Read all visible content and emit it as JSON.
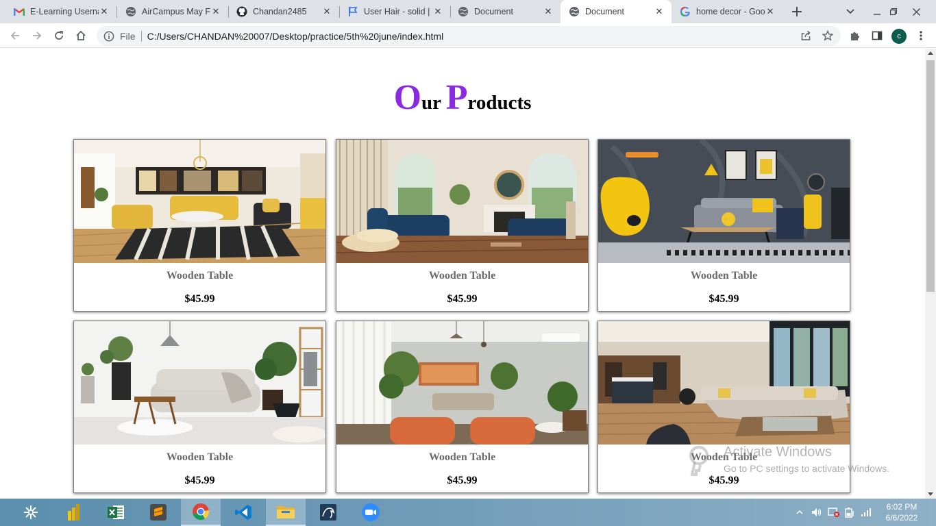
{
  "browser": {
    "tabs": [
      {
        "title": "E-Learning Userna",
        "icon": "gmail-icon",
        "active": false
      },
      {
        "title": "AirCampus May Fu",
        "icon": "globe-icon",
        "active": false
      },
      {
        "title": "Chandan2485",
        "icon": "github-icon",
        "active": false
      },
      {
        "title": "User Hair - solid | F",
        "icon": "flag-icon",
        "active": false
      },
      {
        "title": "Document",
        "icon": "globe-icon",
        "active": false
      },
      {
        "title": "Document",
        "icon": "globe-icon",
        "active": true
      },
      {
        "title": "home decor - Goo",
        "icon": "google-icon",
        "active": false
      }
    ],
    "new_tab_symbol": "+",
    "url_scheme": "File",
    "url": "C:/Users/CHANDAN%20007/Desktop/practice/5th%20june/index.html",
    "profile_initial": "c"
  },
  "page": {
    "heading_first_letter": "O",
    "heading_first_rest": "ur",
    "heading_second_letter": "P",
    "heading_second_rest": "roducts",
    "heading_accent_color": "#8a2be2",
    "products": [
      {
        "name": "Wooden Table",
        "price": "$45.99"
      },
      {
        "name": "Wooden Table",
        "price": "$45.99"
      },
      {
        "name": "Wooden Table",
        "price": "$45.99"
      },
      {
        "name": "Wooden Table",
        "price": "$45.99"
      },
      {
        "name": "Wooden Table",
        "price": "$45.99"
      },
      {
        "name": "Wooden Table",
        "price": "$45.99"
      }
    ]
  },
  "watermark": {
    "title": "Activate Windows",
    "subtitle": "Go to PC settings to activate Windows."
  },
  "taskbar": {
    "apps": [
      "tableau-icon",
      "powerbi-icon",
      "excel-icon",
      "sublime-icon",
      "chrome-icon",
      "vscode-icon",
      "file-explorer-icon",
      "mysql-icon",
      "zoom-icon"
    ],
    "time": "6:02 PM",
    "date": "6/6/2022"
  }
}
